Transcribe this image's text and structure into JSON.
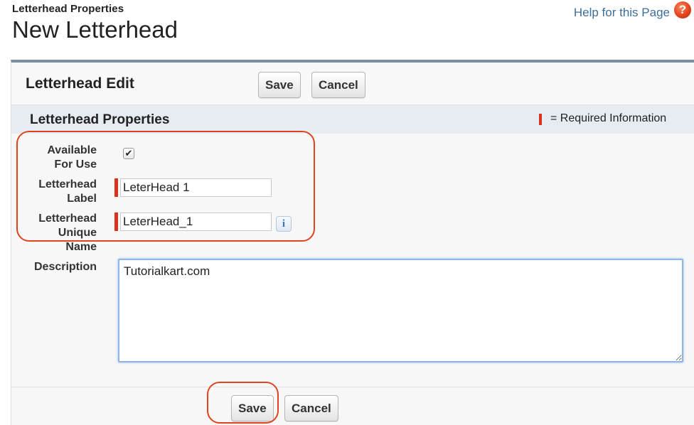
{
  "header": {
    "subtitle": "Letterhead Properties",
    "title": "New Letterhead",
    "help_text": "Help for this Page",
    "help_icon": "?"
  },
  "edit": {
    "title": "Letterhead Edit",
    "save_label": "Save",
    "cancel_label": "Cancel"
  },
  "section": {
    "title": "Letterhead Properties",
    "required_legend": "= Required Information"
  },
  "fields": {
    "available": {
      "label_line1": "Available",
      "label_line2": "For Use",
      "checked": true,
      "check_glyph": "✔"
    },
    "label": {
      "label_line1": "Letterhead",
      "label_line2": "Label",
      "value": "LeterHead 1"
    },
    "unique": {
      "label_line1": "Letterhead",
      "label_line2": "Unique",
      "label_line3": "Name",
      "value": "LeterHead_1",
      "info_glyph": "i"
    },
    "description": {
      "label": "Description",
      "value": "Tutorialkart.com"
    }
  },
  "footer": {
    "save_label": "Save",
    "cancel_label": "Cancel"
  },
  "colors": {
    "required": "#d9331d",
    "annotation": "#e0441f",
    "section_bg": "#e6ecf2",
    "help_link": "#3c6e9a"
  }
}
